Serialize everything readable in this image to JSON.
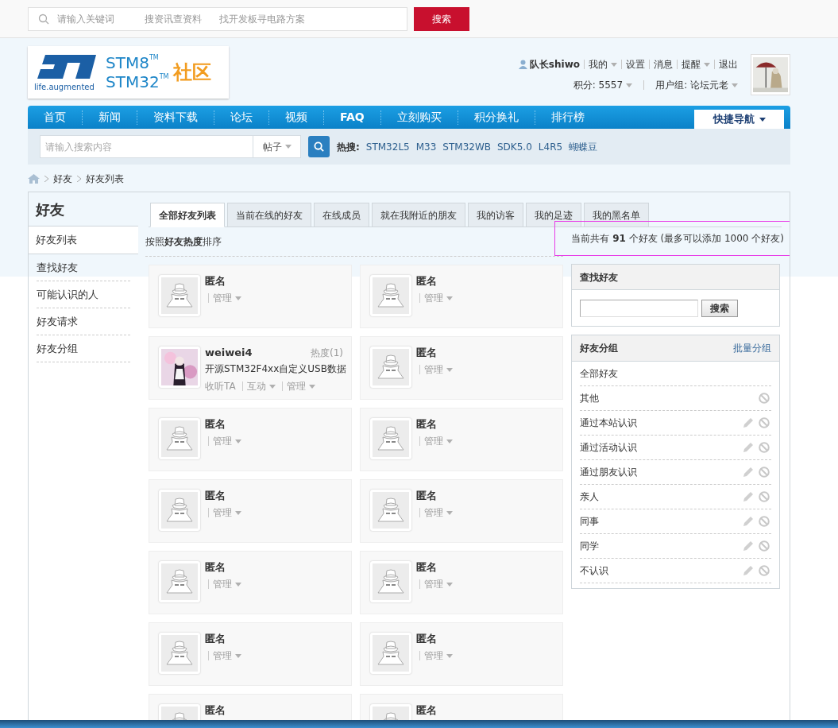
{
  "top_search": {
    "placeholder": "请输入关键词",
    "hints": [
      "搜资讯查资料",
      "找开发板寻电路方案"
    ],
    "button": "搜索"
  },
  "logo": {
    "tagline": "life.augmented",
    "line1": "STM8",
    "line2": "STM32",
    "tm1": "TM",
    "tm2": "TM",
    "community": "社区"
  },
  "user_menu": {
    "username": "队长shiwo",
    "links": [
      {
        "label": "我的",
        "dropdown": true
      },
      {
        "label": "设置",
        "dropdown": false
      },
      {
        "label": "消息",
        "dropdown": false
      },
      {
        "label": "提醒",
        "dropdown": true
      },
      {
        "label": "退出",
        "dropdown": false
      }
    ],
    "points": "积分: 5557",
    "group": "用户组: 论坛元老"
  },
  "nav": {
    "items": [
      {
        "label": "首页",
        "bold": false
      },
      {
        "label": "新闻",
        "bold": false
      },
      {
        "label": "资料下载",
        "bold": false
      },
      {
        "label": "论坛",
        "bold": false
      },
      {
        "label": "视频",
        "bold": false
      },
      {
        "label": "FAQ",
        "bold": true
      },
      {
        "label": "立刻购买",
        "bold": false
      },
      {
        "label": "积分换礼",
        "bold": false
      },
      {
        "label": "排行榜",
        "bold": false
      }
    ],
    "quick_nav": "快捷导航"
  },
  "site_search": {
    "placeholder": "请输入搜索内容",
    "scope": "帖子",
    "hot_label": "热搜:",
    "hot": [
      "STM32L5",
      "M33",
      "STM32WB",
      "SDK5.0",
      "L4R5",
      "蝴蝶豆"
    ]
  },
  "breadcrumb": [
    "好友",
    "好友列表"
  ],
  "sidebar": {
    "title": "好友",
    "items": [
      {
        "label": "好友列表",
        "selected": true
      },
      {
        "label": "查找好友",
        "selected": false
      },
      {
        "label": "可能认识的人",
        "selected": false
      },
      {
        "label": "好友请求",
        "selected": false
      },
      {
        "label": "好友分组",
        "selected": false
      }
    ]
  },
  "tabs": [
    {
      "label": "全部好友列表",
      "selected": true
    },
    {
      "label": "当前在线的好友",
      "selected": false
    },
    {
      "label": "在线成员",
      "selected": false
    },
    {
      "label": "就在我附近的朋友",
      "selected": false
    },
    {
      "label": "我的访客",
      "selected": false
    },
    {
      "label": "我的足迹",
      "selected": false
    },
    {
      "label": "我的黑名单",
      "selected": false
    }
  ],
  "sort_label": "按照**好友热度**排序",
  "summary": {
    "text": "当前共有 **91** 个好友 (最多可以添加 1000 个好友)",
    "highlighted": true
  },
  "friends": [
    {
      "kind": "anonymous",
      "name": "匿名",
      "actions": [
        {
          "label": "管理",
          "dropdown": true,
          "separated": true
        }
      ]
    },
    {
      "kind": "anonymous",
      "name": "匿名",
      "actions": [
        {
          "label": "管理",
          "dropdown": true,
          "separated": true
        }
      ]
    },
    {
      "kind": "user",
      "name": "weiwei4",
      "heat": "热度(1)",
      "status": "开源STM32F4xx自定义USB数据",
      "actions": [
        {
          "label": "收听TA",
          "dropdown": false,
          "separated": false
        },
        {
          "label": "互动",
          "dropdown": true,
          "separated": true
        },
        {
          "label": "管理",
          "dropdown": true,
          "separated": true
        }
      ]
    },
    {
      "kind": "anonymous",
      "name": "匿名",
      "actions": [
        {
          "label": "管理",
          "dropdown": true,
          "separated": true
        }
      ]
    },
    {
      "kind": "anonymous",
      "name": "匿名",
      "actions": [
        {
          "label": "管理",
          "dropdown": true,
          "separated": true
        }
      ]
    },
    {
      "kind": "anonymous",
      "name": "匿名",
      "actions": [
        {
          "label": "管理",
          "dropdown": true,
          "separated": true
        }
      ]
    },
    {
      "kind": "anonymous",
      "name": "匿名",
      "actions": [
        {
          "label": "管理",
          "dropdown": true,
          "separated": true
        }
      ]
    },
    {
      "kind": "anonymous",
      "name": "匿名",
      "actions": [
        {
          "label": "管理",
          "dropdown": true,
          "separated": true
        }
      ]
    },
    {
      "kind": "anonymous",
      "name": "匿名",
      "actions": [
        {
          "label": "管理",
          "dropdown": true,
          "separated": true
        }
      ]
    },
    {
      "kind": "anonymous",
      "name": "匿名",
      "actions": [
        {
          "label": "管理",
          "dropdown": true,
          "separated": true
        }
      ]
    },
    {
      "kind": "anonymous",
      "name": "匿名",
      "actions": [
        {
          "label": "管理",
          "dropdown": true,
          "separated": true
        }
      ]
    },
    {
      "kind": "anonymous",
      "name": "匿名",
      "actions": [
        {
          "label": "管理",
          "dropdown": true,
          "separated": true
        }
      ]
    },
    {
      "kind": "anonymous",
      "name": "匿名"
    },
    {
      "kind": "anonymous",
      "name": "匿名"
    }
  ],
  "find_friend": {
    "title": "查找好友",
    "button": "搜索"
  },
  "groups": {
    "title": "好友分组",
    "batch_link": "批量分组",
    "items": [
      {
        "label": "全部好友",
        "editable": false,
        "deletable": false
      },
      {
        "label": "其他",
        "editable": false,
        "deletable": true
      },
      {
        "label": "通过本站认识",
        "editable": true,
        "deletable": true
      },
      {
        "label": "通过活动认识",
        "editable": true,
        "deletable": true
      },
      {
        "label": "通过朋友认识",
        "editable": true,
        "deletable": true
      },
      {
        "label": "亲人",
        "editable": true,
        "deletable": true
      },
      {
        "label": "同事",
        "editable": true,
        "deletable": true
      },
      {
        "label": "同学",
        "editable": true,
        "deletable": true
      },
      {
        "label": "不认识",
        "editable": true,
        "deletable": true
      }
    ]
  }
}
